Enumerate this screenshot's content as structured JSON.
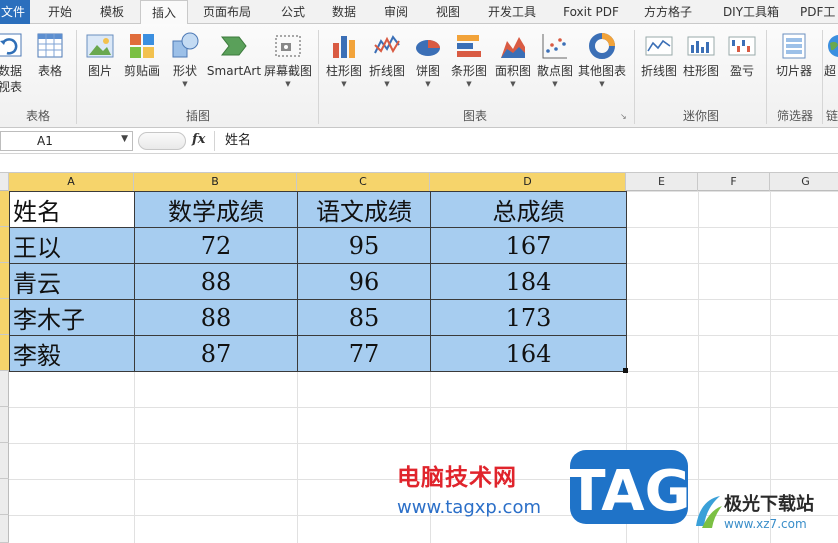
{
  "tabs": [
    {
      "label": "文件",
      "state": "file"
    },
    {
      "label": "开始",
      "state": ""
    },
    {
      "label": "模板",
      "state": ""
    },
    {
      "label": "插入",
      "state": "active"
    },
    {
      "label": "页面布局",
      "state": ""
    },
    {
      "label": "公式",
      "state": ""
    },
    {
      "label": "数据",
      "state": ""
    },
    {
      "label": "审阅",
      "state": ""
    },
    {
      "label": "视图",
      "state": ""
    },
    {
      "label": "开发工具",
      "state": ""
    },
    {
      "label": "Foxit PDF",
      "state": ""
    },
    {
      "label": "方方格子",
      "state": ""
    },
    {
      "label": "DIY工具箱",
      "state": ""
    },
    {
      "label": "PDF工",
      "state": ""
    }
  ],
  "ribbon": {
    "groups": {
      "table": "表格",
      "illustrations": "插图",
      "charts": "图表",
      "sparklines": "迷你图",
      "filter": "筛选器",
      "links": "链"
    },
    "buttons": [
      {
        "id": "pivot",
        "label": "数据",
        "sublabel": "视表",
        "icon": "pivot-table-icon",
        "dropdown": false
      },
      {
        "id": "table",
        "label": "表格",
        "icon": "table-icon",
        "dropdown": false
      },
      {
        "id": "picture",
        "label": "图片",
        "icon": "picture-icon",
        "dropdown": false
      },
      {
        "id": "clipart",
        "label": "剪贴画",
        "icon": "clipart-icon",
        "dropdown": false
      },
      {
        "id": "shapes",
        "label": "形状",
        "icon": "shapes-icon",
        "dropdown": true
      },
      {
        "id": "smartart",
        "label": "SmartArt",
        "icon": "smartart-icon",
        "dropdown": false
      },
      {
        "id": "screenshot",
        "label": "屏幕截图",
        "icon": "screenshot-icon",
        "dropdown": true
      },
      {
        "id": "column-chart",
        "label": "柱形图",
        "icon": "column-chart-icon",
        "dropdown": true
      },
      {
        "id": "line-chart",
        "label": "折线图",
        "icon": "line-chart-icon",
        "dropdown": true
      },
      {
        "id": "pie-chart",
        "label": "饼图",
        "icon": "pie-chart-icon",
        "dropdown": true
      },
      {
        "id": "bar-chart",
        "label": "条形图",
        "icon": "bar-chart-icon",
        "dropdown": true
      },
      {
        "id": "area-chart",
        "label": "面积图",
        "icon": "area-chart-icon",
        "dropdown": true
      },
      {
        "id": "scatter-chart",
        "label": "散点图",
        "icon": "scatter-chart-icon",
        "dropdown": true
      },
      {
        "id": "other-chart",
        "label": "其他图表",
        "icon": "donut-chart-icon",
        "dropdown": true
      },
      {
        "id": "spark-line",
        "label": "折线图",
        "icon": "sparkline-line-icon",
        "dropdown": false
      },
      {
        "id": "spark-column",
        "label": "柱形图",
        "icon": "sparkline-column-icon",
        "dropdown": false
      },
      {
        "id": "spark-winloss",
        "label": "盈亏",
        "icon": "sparkline-winloss-icon",
        "dropdown": false
      },
      {
        "id": "slicer",
        "label": "切片器",
        "icon": "slicer-icon",
        "dropdown": false
      },
      {
        "id": "hyperlink",
        "label": "超",
        "icon": "globe-icon",
        "dropdown": false
      }
    ]
  },
  "formula_bar": {
    "name_box": "A1",
    "fx_label": "fx",
    "content": "姓名"
  },
  "sheet": {
    "columns": [
      "A",
      "B",
      "C",
      "D",
      "E",
      "F",
      "G"
    ],
    "rows": [
      [
        "姓名",
        "数学成绩",
        "语文成绩",
        "总成绩"
      ],
      [
        "王以",
        "72",
        "95",
        "167"
      ],
      [
        "青云",
        "88",
        "96",
        "184"
      ],
      [
        "李木子",
        "88",
        "85",
        "173"
      ],
      [
        "李毅",
        "87",
        "77",
        "164"
      ]
    ],
    "selection_color": "#a7cdf0",
    "header_highlight": "#f6d46b"
  },
  "watermark": {
    "title": "电脑技术网",
    "url": "www.tagxp.com",
    "badge": "TAG",
    "site_name": "极光下载站",
    "site_url": "www.xz7.com"
  }
}
